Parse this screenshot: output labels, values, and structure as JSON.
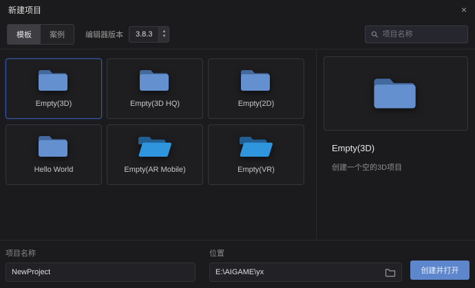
{
  "window": {
    "title": "新建项目",
    "close_label": "×"
  },
  "toolbar": {
    "tabs": [
      {
        "label": "模板",
        "active": true
      },
      {
        "label": "案例",
        "active": false
      }
    ],
    "version_label": "编辑器版本",
    "version_value": "3.8.3",
    "search_placeholder": "项目名称"
  },
  "icons": {
    "stepper_up": "▲",
    "stepper_down": "▼"
  },
  "templates": [
    {
      "label": "Empty(3D)",
      "selected": true,
      "folder": "closed"
    },
    {
      "label": "Empty(3D HQ)",
      "selected": false,
      "folder": "closed"
    },
    {
      "label": "Empty(2D)",
      "selected": false,
      "folder": "closed"
    },
    {
      "label": "Hello World",
      "selected": false,
      "folder": "closed"
    },
    {
      "label": "Empty(AR Mobile)",
      "selected": false,
      "folder": "open"
    },
    {
      "label": "Empty(VR)",
      "selected": false,
      "folder": "open"
    }
  ],
  "detail": {
    "title": "Empty(3D)",
    "description": "创建一个空的3D项目"
  },
  "footer": {
    "name_label": "项目名称",
    "name_value": "NewProject",
    "location_label": "位置",
    "location_value": "E:\\AIGAME\\yx",
    "create_button": "创建并打开"
  },
  "colors": {
    "accent": "#3b5db0",
    "folder_closed": "#6490cf",
    "folder_open": "#2f96dd",
    "create_button": "#5d86cc"
  }
}
